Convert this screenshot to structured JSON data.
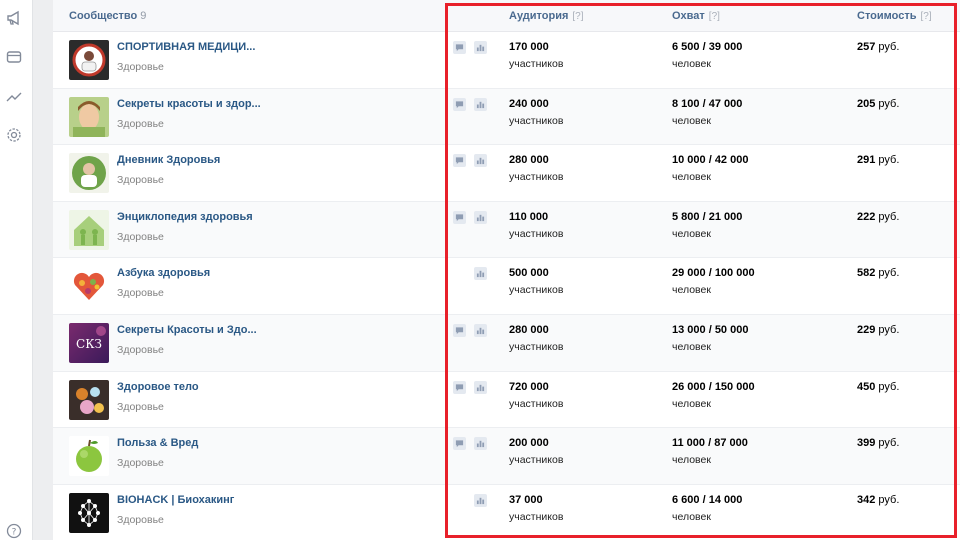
{
  "header": {
    "community_label": "Сообщество",
    "community_count": "9",
    "audience_label": "Аудитория",
    "reach_label": "Охват",
    "cost_label": "Стоимость",
    "hint": "[?]"
  },
  "sidebar": {
    "icons": [
      "megaphone-icon",
      "wallet-icon",
      "trend-icon",
      "gear-icon",
      "help-icon"
    ]
  },
  "accent_color": "#2a5885",
  "highlight_color": "#e8202a",
  "rows": [
    {
      "name": "СПОРТИВНАЯ МЕДИЦИ...",
      "category": "Здоровье",
      "audience": "170 000",
      "audience_unit": "участников",
      "reach": "6 500 / 39 000",
      "reach_unit": "человек",
      "cost": "257",
      "cost_unit": "руб.",
      "has_message": true
    },
    {
      "name": "Секреты красоты и здор...",
      "category": "Здоровье",
      "audience": "240 000",
      "audience_unit": "участников",
      "reach": "8 100 / 47 000",
      "reach_unit": "человек",
      "cost": "205",
      "cost_unit": "руб.",
      "has_message": true
    },
    {
      "name": "Дневник Здоровья",
      "category": "Здоровье",
      "audience": "280 000",
      "audience_unit": "участников",
      "reach": "10 000 / 42 000",
      "reach_unit": "человек",
      "cost": "291",
      "cost_unit": "руб.",
      "has_message": true
    },
    {
      "name": "Энциклопедия здоровья",
      "category": "Здоровье",
      "audience": "110 000",
      "audience_unit": "участников",
      "reach": "5 800 / 21 000",
      "reach_unit": "человек",
      "cost": "222",
      "cost_unit": "руб.",
      "has_message": true
    },
    {
      "name": "Азбука здоровья",
      "category": "Здоровье",
      "audience": "500 000",
      "audience_unit": "участников",
      "reach": "29 000 / 100 000",
      "reach_unit": "человек",
      "cost": "582",
      "cost_unit": "руб.",
      "has_message": false
    },
    {
      "name": "Секреты Красоты и Здо...",
      "category": "Здоровье",
      "audience": "280 000",
      "audience_unit": "участников",
      "reach": "13 000 / 50 000",
      "reach_unit": "человек",
      "cost": "229",
      "cost_unit": "руб.",
      "has_message": true,
      "avatar_text": "СКЗ"
    },
    {
      "name": "Здоровое тело",
      "category": "Здоровье",
      "audience": "720 000",
      "audience_unit": "участников",
      "reach": "26 000 / 150 000",
      "reach_unit": "человек",
      "cost": "450",
      "cost_unit": "руб.",
      "has_message": true
    },
    {
      "name": "Польза & Вред",
      "category": "Здоровье",
      "audience": "200 000",
      "audience_unit": "участников",
      "reach": "11 000 / 87 000",
      "reach_unit": "человек",
      "cost": "399",
      "cost_unit": "руб.",
      "has_message": true
    },
    {
      "name": "BIOHACK | Биохакинг",
      "category": "Здоровье",
      "audience": "37 000",
      "audience_unit": "участников",
      "reach": "6 600 / 14 000",
      "reach_unit": "человек",
      "cost": "342",
      "cost_unit": "руб.",
      "has_message": false
    }
  ]
}
